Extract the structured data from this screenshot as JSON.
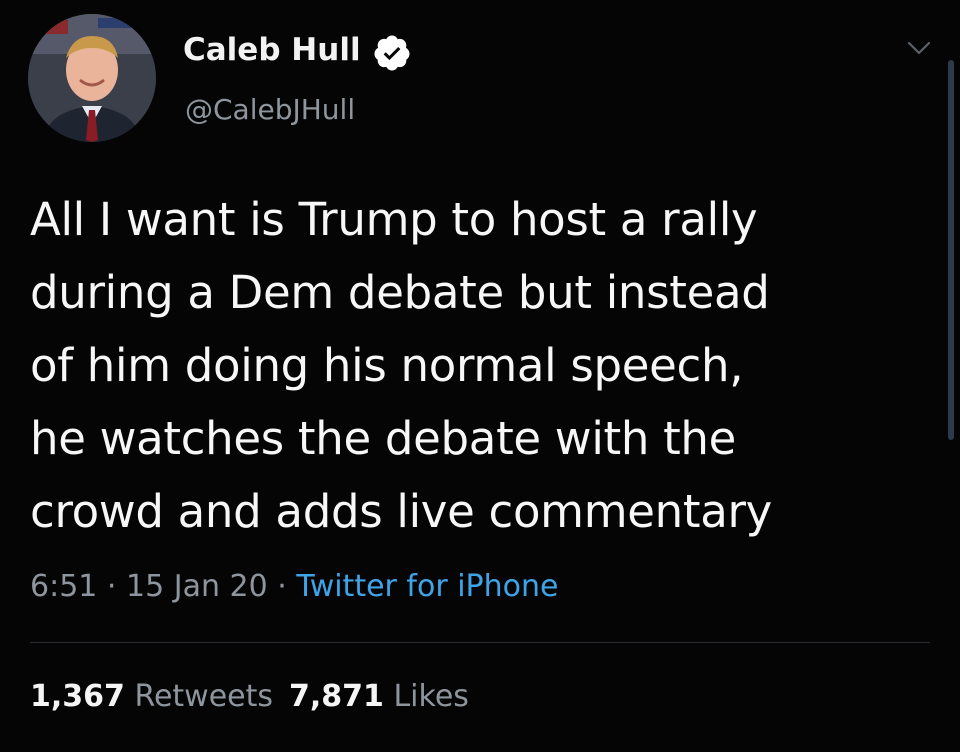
{
  "author": {
    "display_name": "Caleb Hull",
    "handle": "@CalebJHull",
    "verified_icon": "verified-badge-icon"
  },
  "tweet": {
    "text": "All I want is Trump to host a rally\nduring a Dem debate but instead\nof him doing his normal speech,\nhe watches the debate with the\ncrowd and adds live commentary"
  },
  "meta": {
    "time": "6:51",
    "separator": "·",
    "date": "15 Jan 20",
    "source": "Twitter for iPhone"
  },
  "stats": {
    "retweets_count": "1,367",
    "retweets_label": "Retweets",
    "likes_count": "7,871",
    "likes_label": "Likes"
  },
  "colors": {
    "background": "#050506",
    "text": "#f7f7f7",
    "secondary": "#8e959c",
    "link": "#3fa3e8",
    "verified": "#ffffff"
  }
}
